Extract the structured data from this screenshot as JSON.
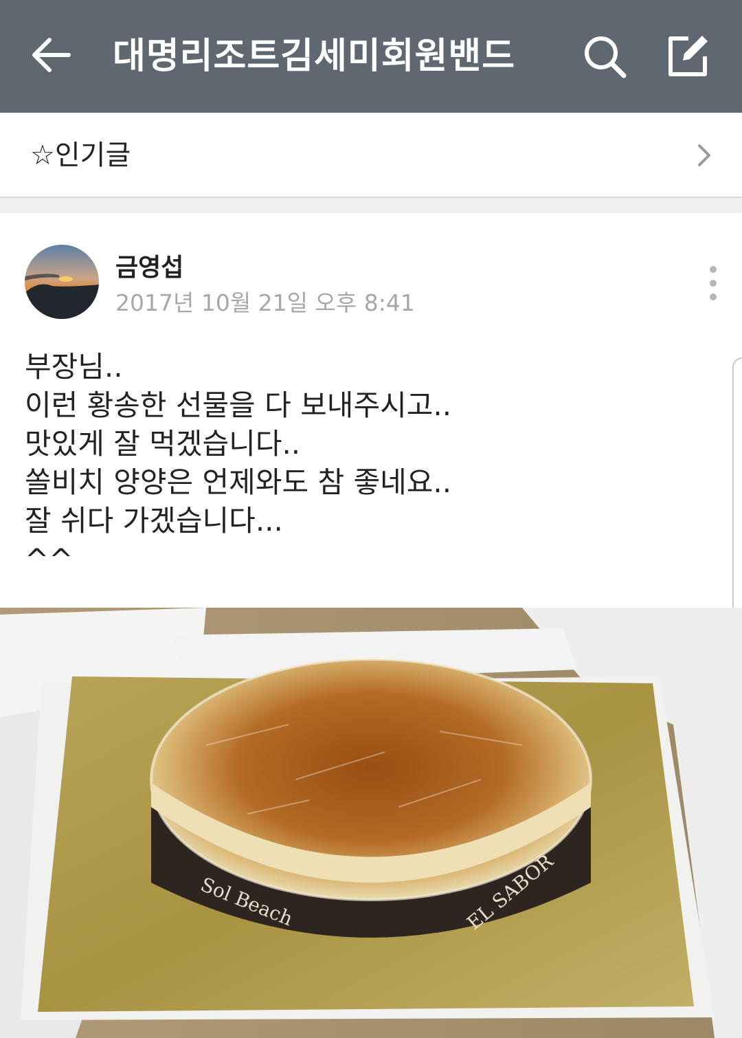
{
  "header": {
    "title": "대명리조트김세미회원밴드",
    "back_icon": "back-arrow-icon",
    "search_icon": "search-icon",
    "compose_icon": "compose-icon",
    "background": "#5f6770"
  },
  "popular": {
    "label": "☆인기글",
    "chevron_icon": "chevron-right-icon"
  },
  "post": {
    "author": "금영섭",
    "timestamp": "2017년 10월 21일 오후 8:41",
    "more_icon": "more-vertical-icon",
    "lines": [
      "부장님..",
      "이런 황송한 선물을 다 보내주시고..",
      "맛있게 잘 먹겠습니다..",
      "쏠비치 양양은 언제와도 참 좋네요..",
      "잘 쉬다 가겠습니다...",
      "^^"
    ],
    "photo": {
      "band_left": "Sol Beach",
      "band_right": "EL SABOR"
    }
  }
}
